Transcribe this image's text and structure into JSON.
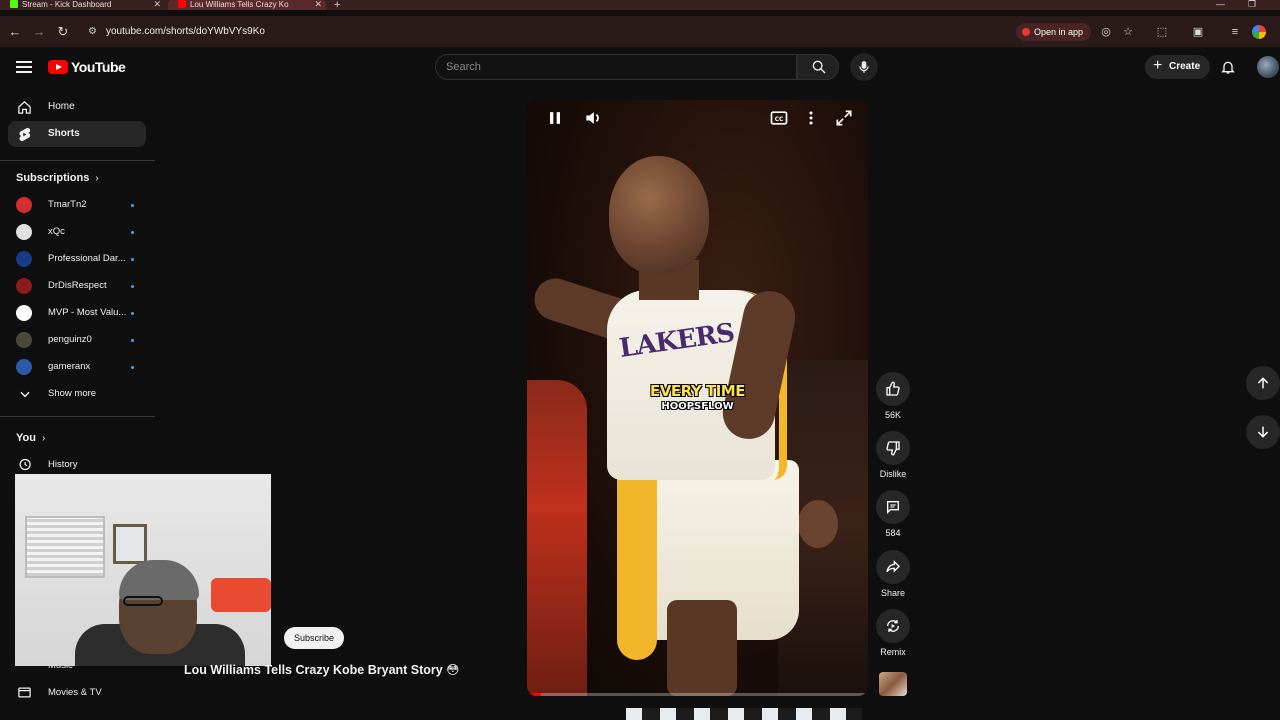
{
  "browser": {
    "tabs": [
      {
        "title": "Stream - Kick Dashboard",
        "active": false,
        "icon_color": "#53fc18"
      },
      {
        "title": "Lou Williams Tells Crazy Ko",
        "active": true,
        "icon_color": "#ff0000"
      }
    ],
    "url": "youtube.com/shorts/doYWbVYs9Ko",
    "open_in_app_label": "Open in app"
  },
  "header": {
    "logo_text": "YouTube",
    "search_placeholder": "Search",
    "create_label": "Create"
  },
  "sidebar": {
    "main_items": [
      {
        "label": "Home",
        "icon": "home-icon",
        "active": false
      },
      {
        "label": "Shorts",
        "icon": "shorts-icon",
        "active": true
      }
    ],
    "subscriptions_heading": "Subscriptions",
    "subscriptions": [
      {
        "name": "TmarTn2",
        "avatar_color": "#d32f2f"
      },
      {
        "name": "xQc",
        "avatar_color": "#e0e0e0"
      },
      {
        "name": "Professional Dar...",
        "avatar_color": "#1a3a8a"
      },
      {
        "name": "DrDisRespect",
        "avatar_color": "#8b1a1a"
      },
      {
        "name": "MVP - Most Valu...",
        "avatar_color": "#ffffff"
      },
      {
        "name": "penguinz0",
        "avatar_color": "#4a4a3a"
      },
      {
        "name": "gameranx",
        "avatar_color": "#2a5aa8"
      }
    ],
    "show_more_label": "Show more",
    "you_heading": "You",
    "you_items": [
      {
        "label": "History",
        "icon": "history-icon"
      }
    ],
    "bottom_items": [
      {
        "label": "Music",
        "icon": "music-icon"
      },
      {
        "label": "Movies & TV",
        "icon": "movies-icon"
      }
    ]
  },
  "short": {
    "title": "Lou Williams Tells Crazy Kobe Bryant Story 😳",
    "caption_main": "EVERY TIME",
    "caption_sub": "HOOPSFLOW",
    "jersey_text": "LAKERS",
    "subscribe_label": "Subscribe",
    "progress": 0.04
  },
  "actions": {
    "likes": "56K",
    "dislike_label": "Dislike",
    "comments": "584",
    "share_label": "Share",
    "remix_label": "Remix"
  },
  "colors": {
    "brand_red": "#ff0000",
    "background": "#0f0f0f",
    "chip": "#272727",
    "subscription_dot": "#3ea6ff"
  }
}
